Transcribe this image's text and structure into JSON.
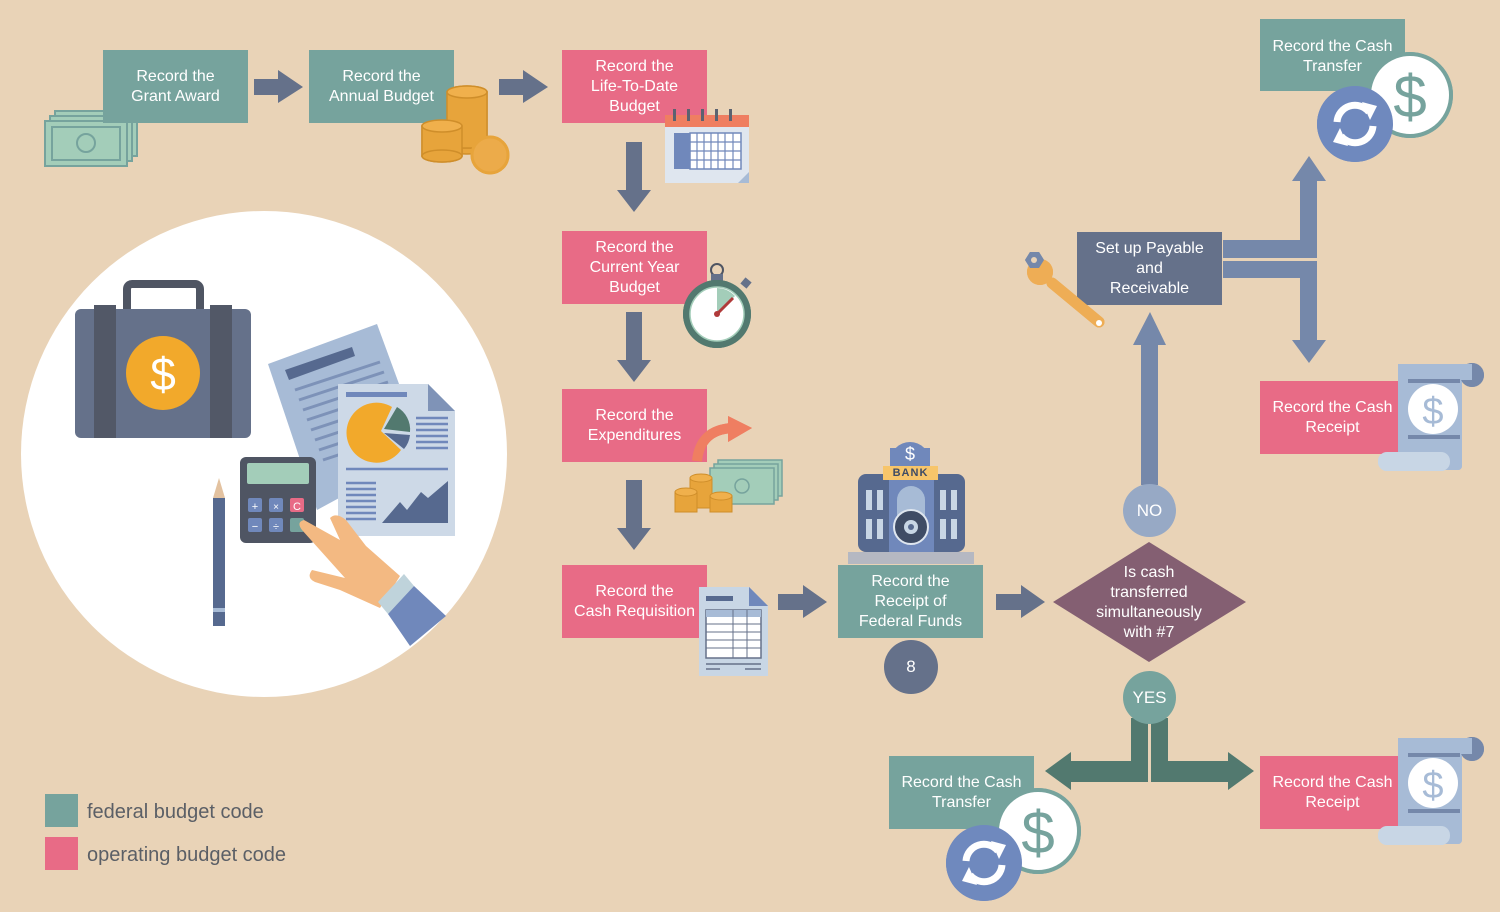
{
  "colors": {
    "background": "#e9d3b7",
    "federal": "#76a39d",
    "operating": "#e86b86",
    "process_dark": "#65718a",
    "decision": "#845f72",
    "arrow": "#65718a",
    "arrow_light": "#7588aa",
    "arrow_yes": "#52796f"
  },
  "nodes": {
    "grant_award": "Record the\nGrant Award",
    "annual_budget": "Record the\nAnnual Budget",
    "life_to_date": "Record the\nLife-To-Date\nBudget",
    "current_year": "Record the\nCurrent Year\nBudget",
    "expenditures": "Record the\nExpenditures",
    "cash_requisition": "Record the\nCash Requisition",
    "federal_funds": "Record the\nReceipt of\nFederal Funds",
    "payable_receivable": "Set up Payable\nand\nReceivable",
    "cash_transfer_top": "Record the Cash\nTransfer",
    "cash_receipt_top": "Record the Cash\nReceipt",
    "cash_transfer_bottom": "Record the Cash\nTransfer",
    "cash_receipt_bottom": "Record the Cash\nReceipt"
  },
  "decision": {
    "question": "Is cash\ntransferred\nsimultaneously\nwith #7",
    "no_label": "NO",
    "yes_label": "YES"
  },
  "step_badge": "8",
  "bank_sign": "BANK",
  "legend": [
    {
      "label": "federal budget code",
      "color": "#76a39d"
    },
    {
      "label": "operating budget code",
      "color": "#e86b86"
    }
  ]
}
